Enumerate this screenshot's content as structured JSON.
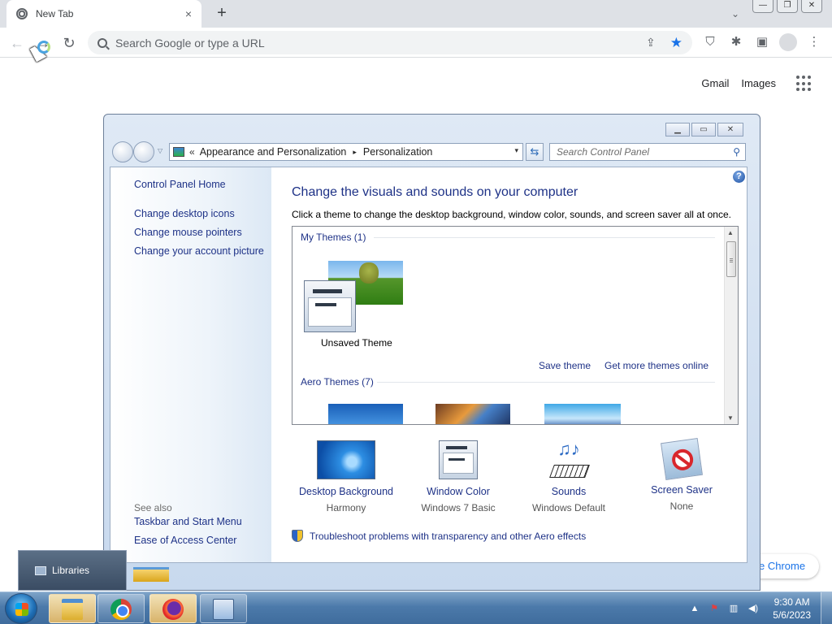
{
  "browser": {
    "tab": {
      "title": "New Tab",
      "close": "×"
    },
    "new_tab": "+",
    "tab_search": "⌄",
    "window_controls": {
      "minimize": "—",
      "restore": "❐",
      "close": "✕"
    },
    "nav": {
      "back": "←",
      "forward": "→",
      "reload": "↻"
    },
    "omnibox": {
      "placeholder": "Search Google or type a URL",
      "share": "⇪",
      "bookmark": "★"
    },
    "toolbar_icons": {
      "shield": "⛉",
      "extensions": "✱",
      "sidepanel": "▣",
      "menu": "⋮"
    },
    "ntp_links": [
      "Gmail",
      "Images"
    ],
    "customize": "e Chrome"
  },
  "control_panel": {
    "caption": {
      "minimize": "▁",
      "maximize": "▭",
      "close": "✕"
    },
    "breadcrumb": [
      "Appearance and Personalization",
      "Personalization"
    ],
    "breadcrumb_prefix": "«",
    "breadcrumb_sep": "▸",
    "address_dropdown": "▾",
    "refresh": "⇆",
    "search_placeholder": "Search Control Panel",
    "search_lens": "⚲",
    "help": "?",
    "sidebar": {
      "home": "Control Panel Home",
      "links": [
        "Change desktop icons",
        "Change mouse pointers",
        "Change your account picture"
      ],
      "see_also_title": "See also",
      "see_also": [
        "Taskbar and Start Menu",
        "Ease of Access Center"
      ]
    },
    "heading": "Change the visuals and sounds on your computer",
    "description": "Click a theme to change the desktop background, window color, sounds, and screen saver all at once.",
    "themes": {
      "my_themes_header": "My Themes (1)",
      "unsaved_theme": "Unsaved Theme",
      "save_theme": "Save theme",
      "get_more": "Get more themes online",
      "aero_header": "Aero Themes (7)",
      "scroll_up": "▲",
      "scroll_down": "▼"
    },
    "settings": [
      {
        "label": "Desktop Background",
        "value": "Harmony"
      },
      {
        "label": "Window Color",
        "value": "Windows 7 Basic"
      },
      {
        "label": "Sounds",
        "value": "Windows Default"
      },
      {
        "label": "Screen Saver",
        "value": "None"
      }
    ],
    "troubleshoot": "Troubleshoot problems with transparency and other Aero effects"
  },
  "libraries_popup": "Libraries",
  "taskbar": {
    "tray_icons": {
      "show_hidden": "▲",
      "action_center": "⚑",
      "network": "▥",
      "volume": "◀)"
    },
    "time": "9:30 AM",
    "date": "5/6/2023"
  }
}
